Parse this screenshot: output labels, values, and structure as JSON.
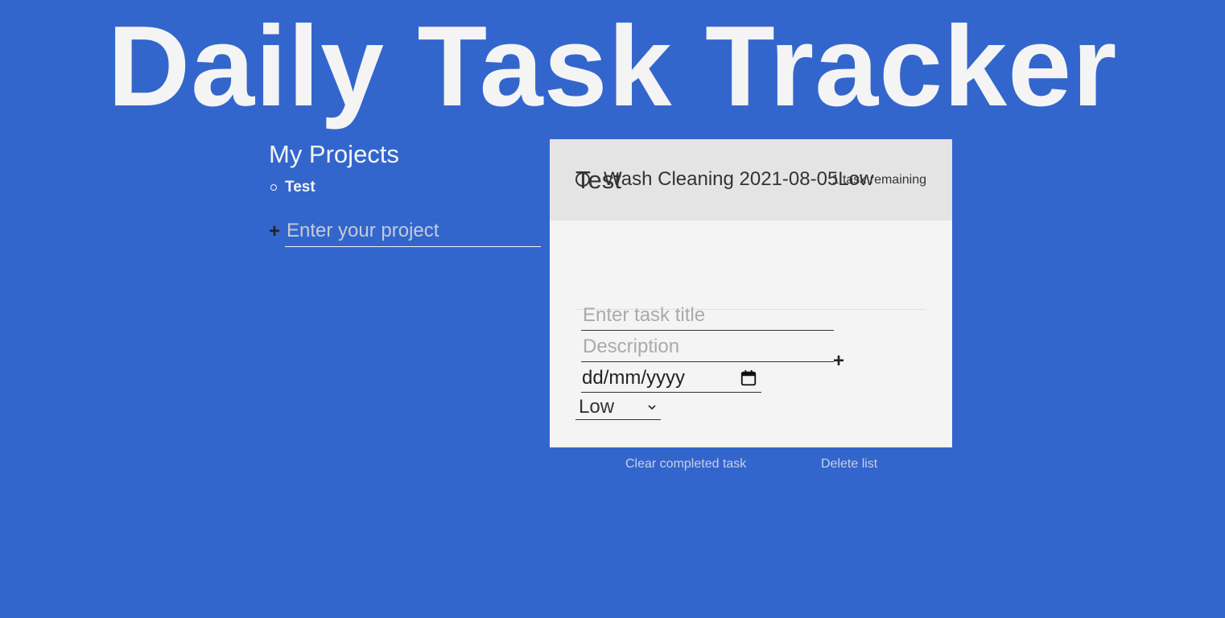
{
  "app": {
    "title": "Daily Task Tracker"
  },
  "sidebar": {
    "title": "My Projects",
    "projects": [
      {
        "label": "Test"
      }
    ],
    "new_project": {
      "add_label": "+",
      "placeholder": "Enter your project"
    }
  },
  "list": {
    "title": "Test",
    "remaining": "1 task remaining",
    "tasks": [
      {
        "label": "Wash Cleaning 2021-08-05Low"
      }
    ],
    "new_task": {
      "title_placeholder": "Enter task title",
      "description_placeholder": "Description",
      "date_placeholder": "dd/mm/yyyy",
      "priority": "Low",
      "add_label": "+"
    }
  },
  "actions": {
    "clear_completed": "Clear completed task",
    "delete_list": "Delete list"
  },
  "colors": {
    "background": "#3366cc",
    "panel": "#f4f4f4",
    "panel_header": "#e4e4e4",
    "text_light": "#f4f4f4",
    "text_dark": "#333333"
  }
}
